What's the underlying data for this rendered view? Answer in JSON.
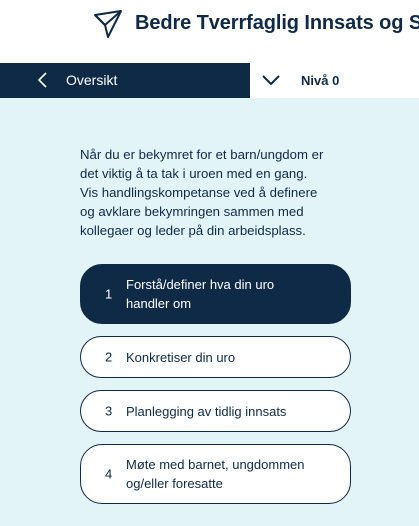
{
  "header": {
    "title": "Bedre Tverrfaglig Innsats og Samhandling",
    "logo_icon": "paper-plane-icon"
  },
  "nav": {
    "back_label": "Oversikt",
    "back_icon": "chevron-left-icon",
    "level_label": "Nivå 0",
    "level_icon": "chevron-down-icon"
  },
  "intro": {
    "line1": "Når du er bekymret for et barn/ungdom er",
    "line2": "det viktig å ta tak i uroen med en gang.",
    "line3": "Vis handlingskompetanse ved å definere",
    "line4": "og avklare bekymringen sammen med",
    "line5": "kollegaer og leder på din arbeidsplass."
  },
  "steps": [
    {
      "number": "1",
      "line1": "Forstå/definer hva din uro",
      "line2": "handler om",
      "active": true
    },
    {
      "number": "2",
      "line1": "Konkretiser din uro",
      "active": false
    },
    {
      "number": "3",
      "line1": "Planlegging av tidlig innsats",
      "active": false
    },
    {
      "number": "4",
      "line1": "Møte med barnet, ungdommen",
      "line2": "og/eller foresatte",
      "active": false
    }
  ],
  "colors": {
    "primary": "#0e2a47",
    "background": "#e3f4f9",
    "surface": "#ffffff"
  }
}
